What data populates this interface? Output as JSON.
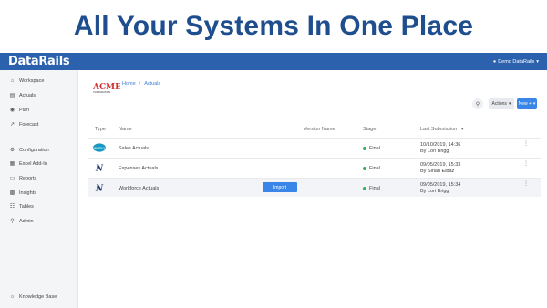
{
  "headline": "All Your Systems In One Place",
  "topbar": {
    "logo": "DataRails",
    "user": "Demo DataRails"
  },
  "sidebar": {
    "items": [
      {
        "label": "Workspace",
        "icon": "home-icon"
      },
      {
        "label": "Actuals",
        "icon": "database-icon"
      },
      {
        "label": "Plan",
        "icon": "binoculars-icon"
      },
      {
        "label": "Forecast",
        "icon": "chart-icon"
      },
      {
        "label": "Configuration",
        "icon": "gear-icon"
      },
      {
        "label": "Excel Add-In",
        "icon": "excel-icon"
      },
      {
        "label": "Reports",
        "icon": "reports-icon"
      },
      {
        "label": "Insights",
        "icon": "insights-icon"
      },
      {
        "label": "Tables",
        "icon": "table-icon"
      },
      {
        "label": "Admin",
        "icon": "admin-icon"
      }
    ],
    "footer": {
      "label": "Knowledge Base",
      "icon": "lightbulb-icon"
    }
  },
  "breadcrumb": {
    "logo_text": "ACME",
    "logo_sub": "CORPORATION",
    "home": "Home",
    "sep": "/",
    "current": "Actuals"
  },
  "toolbar": {
    "actions": "Actions",
    "new": "New +"
  },
  "table": {
    "headers": {
      "type": "Type",
      "name": "Name",
      "version": "Version Name",
      "stage": "Stage",
      "last": "Last Submission"
    },
    "rows": [
      {
        "type": "salesforce",
        "type_label": "salesforce",
        "name": "Sales Actuals",
        "stage": "Final",
        "date": "10/10/2019, 14:36",
        "by": "By Lori Brigg"
      },
      {
        "type": "netsuite",
        "type_label": "N",
        "name": "Expenses Actuals",
        "stage": "Final",
        "date": "09/05/2019, 15:33",
        "by": "By Sinan Elbaz"
      },
      {
        "type": "netsuite",
        "type_label": "N",
        "name": "Workforce Actuals",
        "stage": "Final",
        "date": "09/05/2019, 15:34",
        "by": "By Lori Brigg",
        "import": "Import"
      }
    ]
  },
  "colors": {
    "brand": "#2c62ad",
    "headline": "#1f4e8e",
    "primary_button": "#3a86e8",
    "final_dot": "#2eb35a"
  }
}
